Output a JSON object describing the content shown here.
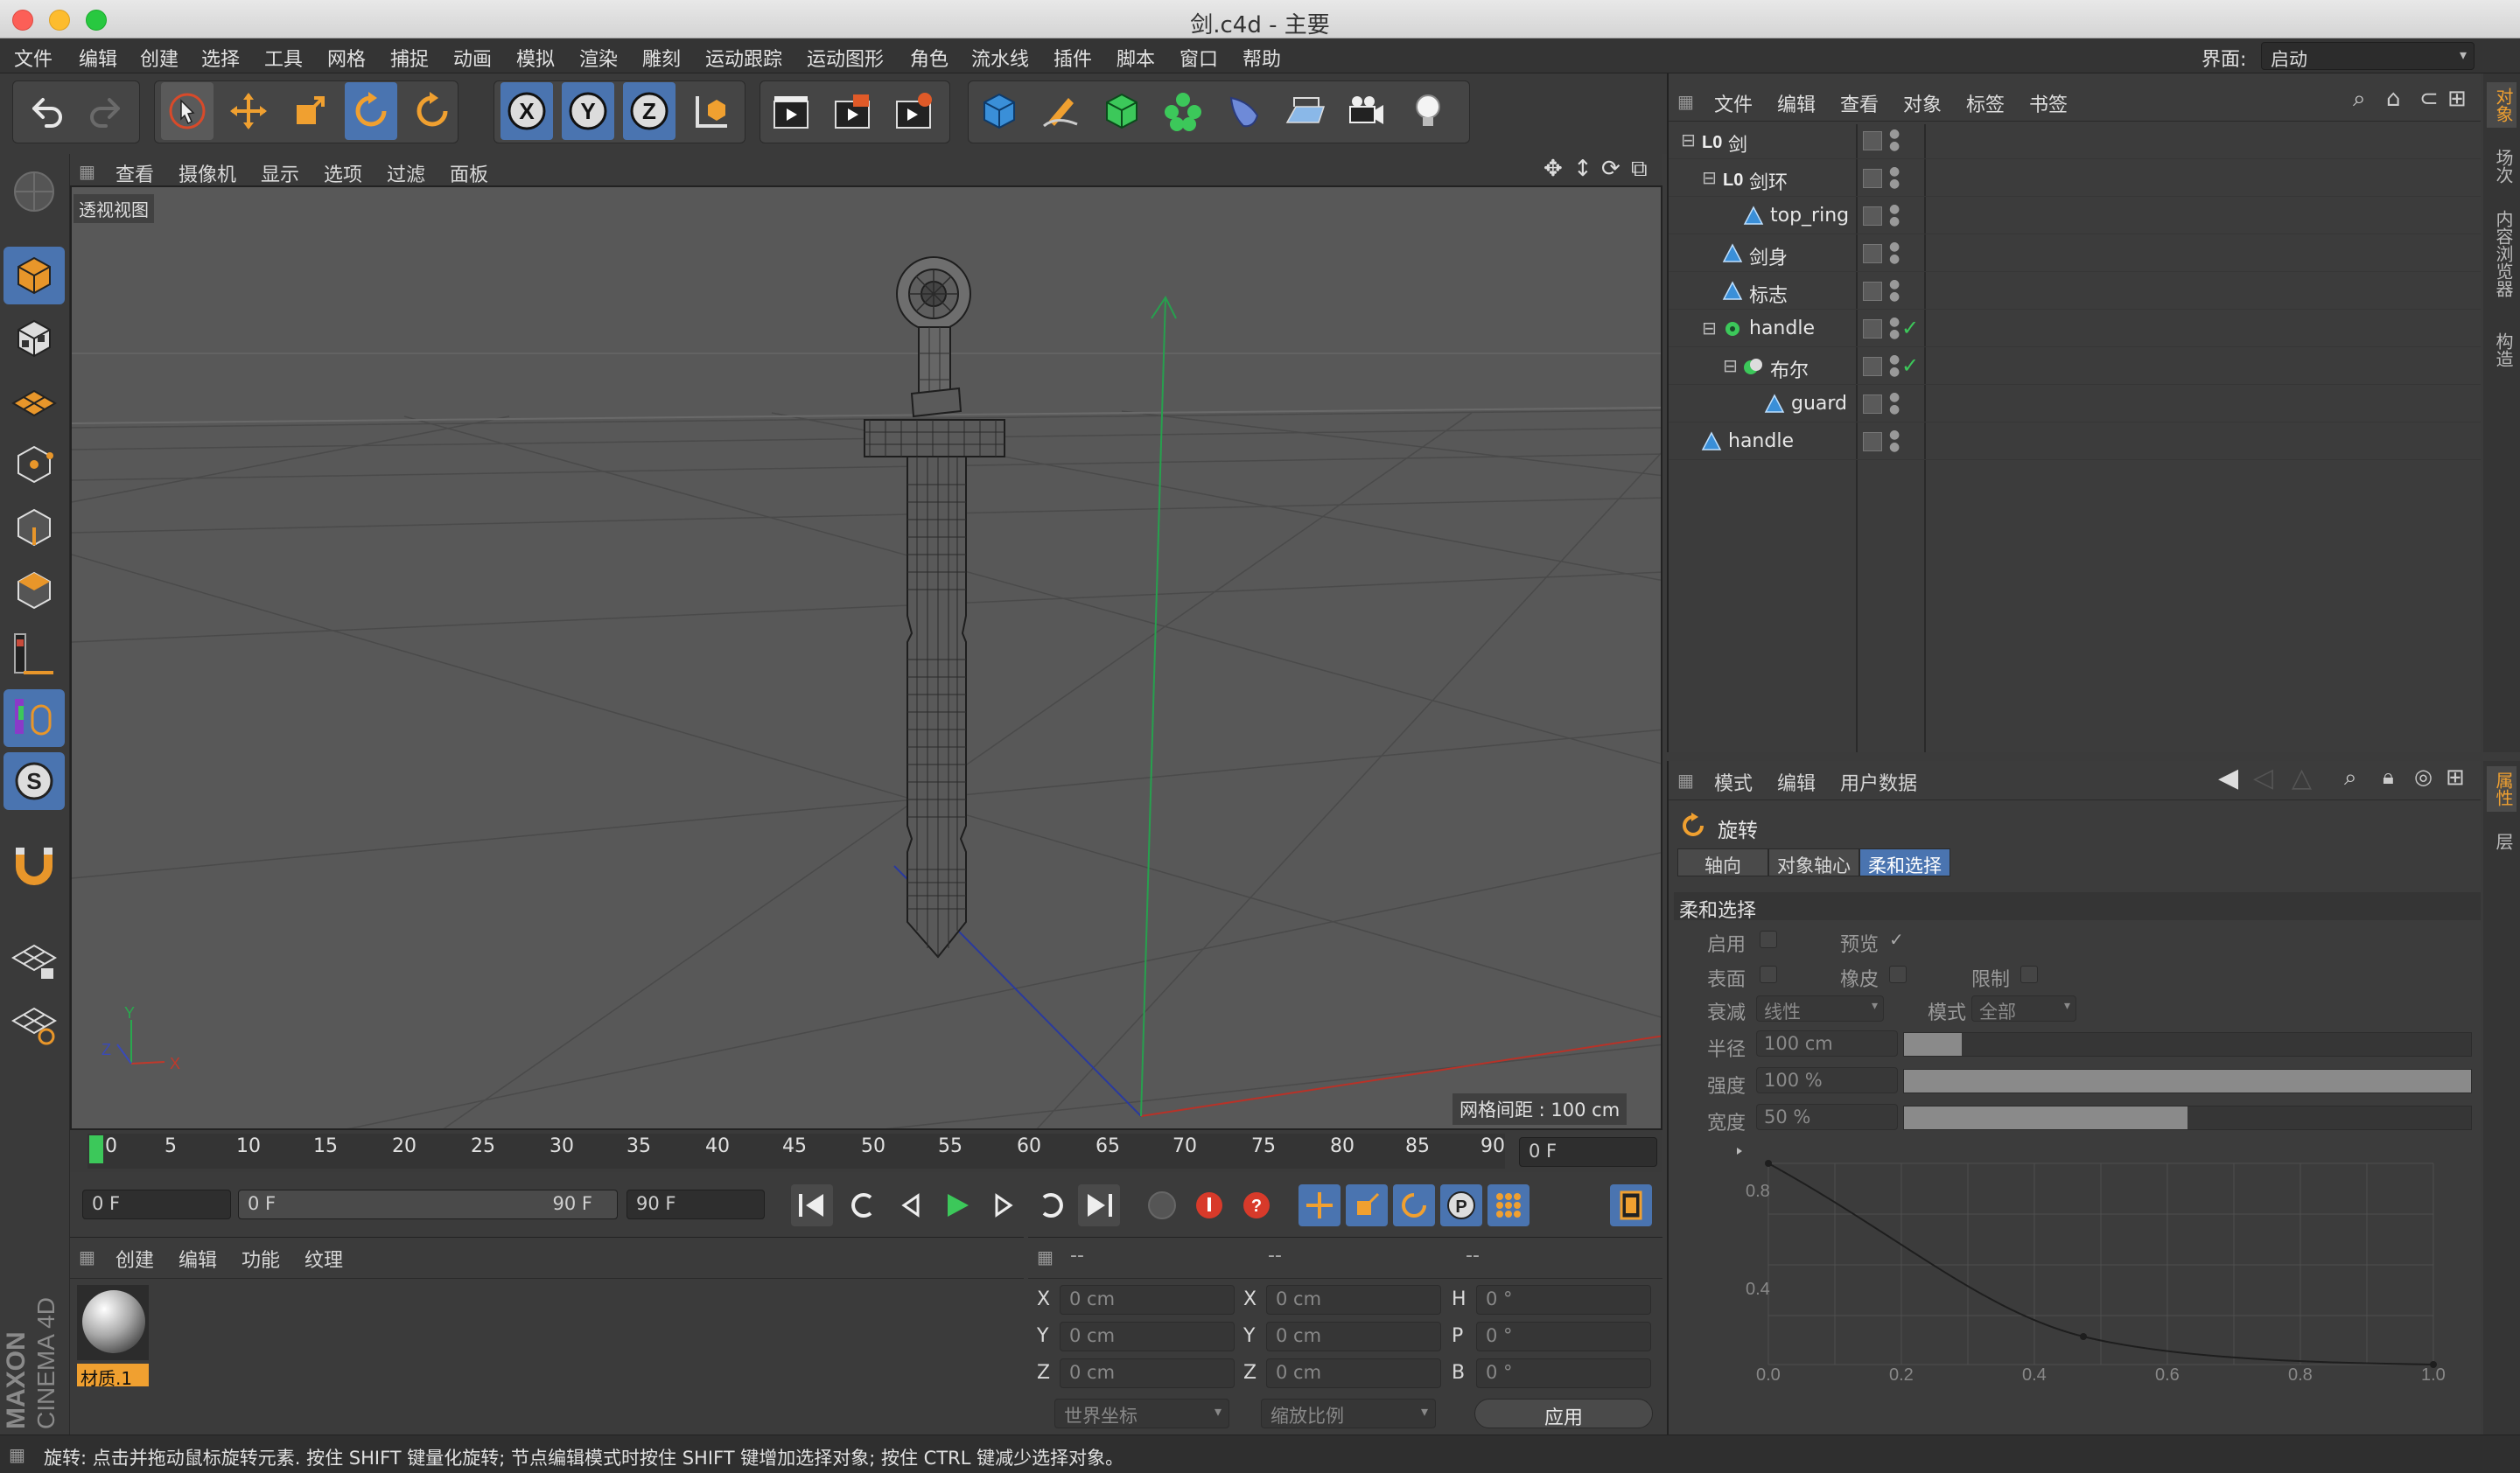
{
  "window": {
    "title": "剑.c4d - 主要"
  },
  "menu": {
    "items": [
      "文件",
      "编辑",
      "创建",
      "选择",
      "工具",
      "网格",
      "捕捉",
      "动画",
      "模拟",
      "渲染",
      "雕刻",
      "运动跟踪",
      "运动图形",
      "角色",
      "流水线",
      "插件",
      "脚本",
      "窗口",
      "帮助"
    ],
    "layout_label": "界面:",
    "layout_value": "启动"
  },
  "viewport": {
    "menu": [
      "查看",
      "摄像机",
      "显示",
      "选项",
      "过滤",
      "面板"
    ],
    "label": "透视视图",
    "grid_spacing": "网格间距 : 100 cm",
    "axis": {
      "x": "X",
      "y": "Y",
      "z": "Z"
    }
  },
  "timeline": {
    "ticks": [
      "0",
      "5",
      "10",
      "15",
      "20",
      "25",
      "30",
      "35",
      "40",
      "45",
      "50",
      "55",
      "60",
      "65",
      "70",
      "75",
      "80",
      "85",
      "90"
    ],
    "current_frame": "0 F",
    "start_frame": "0 F",
    "range_start": "0 F",
    "range_end": "90 F",
    "end_frame": "90 F"
  },
  "materials": {
    "menu": [
      "创建",
      "编辑",
      "功能",
      "纹理"
    ],
    "items": [
      {
        "name": "材质.1"
      }
    ]
  },
  "coords": {
    "header": [
      "--",
      "--",
      "--"
    ],
    "rows": [
      {
        "l1": "X",
        "v1": "0 cm",
        "l2": "X",
        "v2": "0 cm",
        "l3": "H",
        "v3": "0 °"
      },
      {
        "l1": "Y",
        "v1": "0 cm",
        "l2": "Y",
        "v2": "0 cm",
        "l3": "P",
        "v3": "0 °"
      },
      {
        "l1": "Z",
        "v1": "0 cm",
        "l2": "Z",
        "v2": "0 cm",
        "l3": "B",
        "v3": "0 °"
      }
    ],
    "world_coords": "世界坐标",
    "scale": "缩放比例",
    "apply": "应用"
  },
  "status": {
    "text": "旋转: 点击并拖动鼠标旋转元素. 按住 SHIFT 键量化旋转; 节点编辑模式时按住 SHIFT 键增加选择对象; 按住 CTRL 键减少选择对象。"
  },
  "objects": {
    "menu": [
      "文件",
      "编辑",
      "查看",
      "对象",
      "标签",
      "书签"
    ],
    "tree": [
      {
        "name": "剑",
        "indent": 0,
        "icon": "null",
        "check": false
      },
      {
        "name": "剑环",
        "indent": 1,
        "icon": "null",
        "check": false
      },
      {
        "name": "top_ring",
        "indent": 2,
        "icon": "poly",
        "check": false
      },
      {
        "name": "剑身",
        "indent": 1,
        "icon": "poly",
        "check": false
      },
      {
        "name": "标志",
        "indent": 1,
        "icon": "poly",
        "check": false
      },
      {
        "name": "handle",
        "indent": 1,
        "icon": "gear",
        "check": true
      },
      {
        "name": "布尔",
        "indent": 2,
        "icon": "boole",
        "check": true
      },
      {
        "name": "guard",
        "indent": 3,
        "icon": "poly",
        "check": false
      },
      {
        "name": "handle",
        "indent": 0,
        "icon": "poly",
        "check": false
      }
    ]
  },
  "attributes": {
    "menu": [
      "模式",
      "编辑",
      "用户数据"
    ],
    "tool_name": "旋转",
    "tabs": [
      "轴向",
      "对象轴心",
      "柔和选择"
    ],
    "active_tab": "柔和选择",
    "section": "柔和选择",
    "enable": "启用",
    "preview": "预览",
    "surface": "表面",
    "rubber": "橡皮",
    "limit": "限制",
    "falloff_label": "衰减",
    "falloff_value": "线性",
    "mode_label": "模式",
    "mode_value": "全部",
    "radius_label": "半径",
    "radius_value": "100 cm",
    "strength_label": "强度",
    "strength_value": "100 %",
    "width_label": "宽度",
    "width_value": "50 %",
    "graph_x": [
      "0.0",
      "0.2",
      "0.4",
      "0.6",
      "0.8",
      "1.0"
    ],
    "graph_y": [
      "0.8",
      "0.4"
    ]
  },
  "side_tabs_top": [
    "对象",
    "场次",
    "内容浏览器",
    "构造"
  ],
  "side_tabs_bottom": [
    "属性",
    "层"
  ],
  "logo": {
    "brand": "MAXON",
    "product": "CINEMA 4D"
  },
  "colors": {
    "accent": "#f0a030",
    "selected_tab": "#4a74b0",
    "x_axis": "#c0392b",
    "y_axis": "#27ae60",
    "z_axis": "#2c3e9e"
  }
}
